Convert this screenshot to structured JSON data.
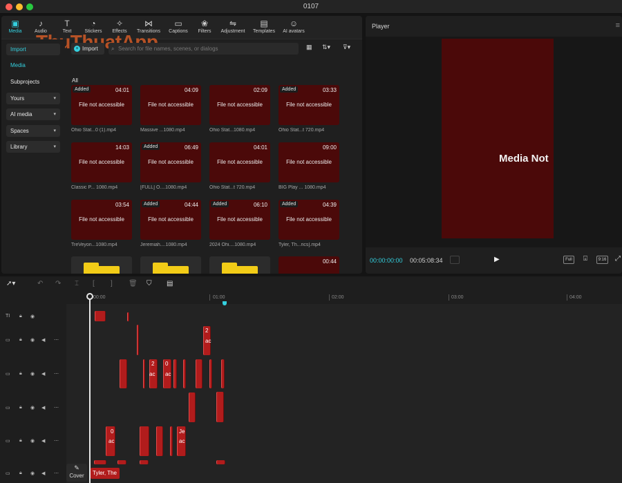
{
  "window": {
    "title": "0107"
  },
  "watermark": {
    "text": "ThuThuatApp"
  },
  "toolbar": {
    "items": [
      {
        "label": "Media",
        "icon": "media-icon"
      },
      {
        "label": "Audio",
        "icon": "audio-icon"
      },
      {
        "label": "Text",
        "icon": "text-icon"
      },
      {
        "label": "Stickers",
        "icon": "stickers-icon"
      },
      {
        "label": "Effects",
        "icon": "effects-icon"
      },
      {
        "label": "Transitions",
        "icon": "transitions-icon"
      },
      {
        "label": "Captions",
        "icon": "captions-icon"
      },
      {
        "label": "Filters",
        "icon": "filters-icon"
      },
      {
        "label": "Adjustment",
        "icon": "adjustment-icon"
      },
      {
        "label": "Templates",
        "icon": "templates-icon"
      },
      {
        "label": "AI avatars",
        "icon": "ai-avatars-icon"
      }
    ]
  },
  "sidebar": {
    "import": "Import",
    "media": "Media",
    "subprojects": "Subprojects",
    "yours": "Yours",
    "ai_media": "AI media",
    "spaces": "Spaces",
    "library": "Library"
  },
  "media": {
    "import_button": "Import",
    "search_placeholder": "Search for file names, scenes, or dialogs",
    "filter_label": "All",
    "not_accessible": "File not accessible",
    "added_badge": "Added",
    "items": [
      {
        "added": true,
        "duration": "04:01",
        "name": "Ohio Stat...0 (1).mp4"
      },
      {
        "added": false,
        "duration": "04:09",
        "name": "Massive ...1080.mp4"
      },
      {
        "added": false,
        "duration": "02:09",
        "name": "Ohio Stat...1080.mp4"
      },
      {
        "added": true,
        "duration": "03:33",
        "name": "Ohio Stat...t 720.mp4"
      },
      {
        "added": false,
        "duration": "14:03",
        "name": "Classic P... 1080.mp4"
      },
      {
        "added": true,
        "duration": "06:49",
        "name": "[FULL] O....1080.mp4"
      },
      {
        "added": false,
        "duration": "04:01",
        "name": "Ohio Stat...t 720.mp4"
      },
      {
        "added": false,
        "duration": "09:00",
        "name": "BIG Play ... 1080.mp4"
      },
      {
        "added": false,
        "duration": "03:54",
        "name": "TreVeyon...1080.mp4"
      },
      {
        "added": true,
        "duration": "04:44",
        "name": "Jeremiah....1080.mp4"
      },
      {
        "added": true,
        "duration": "06:10",
        "name": "2024 Ohi....1080.mp4"
      },
      {
        "added": true,
        "duration": "04:39",
        "name": "Tyler, Th...rics].mp4"
      },
      {
        "added": false,
        "duration": "00:44",
        "name": ""
      }
    ]
  },
  "player": {
    "title": "Player",
    "media_message": "Media Not",
    "current_time": "00:00:00:00",
    "total_time": "00:05:08:34",
    "full_label": "Full",
    "ratio_label": "9:16"
  },
  "timeline": {
    "ruler": [
      "00:00",
      "01:00",
      "02:00",
      "03:00",
      "04:00"
    ],
    "cover_label": "Cover",
    "bottom_clip_label": "Tyler, The",
    "clip_texts": [
      "2",
      "ac",
      "2",
      "ac",
      "0",
      "ac",
      "0",
      "ac",
      "Je",
      "ac"
    ]
  },
  "colors": {
    "accent": "#34d0df",
    "clip": "#b11c1c",
    "thumbnail": "#4b0909",
    "folder": "#f2cc17"
  }
}
